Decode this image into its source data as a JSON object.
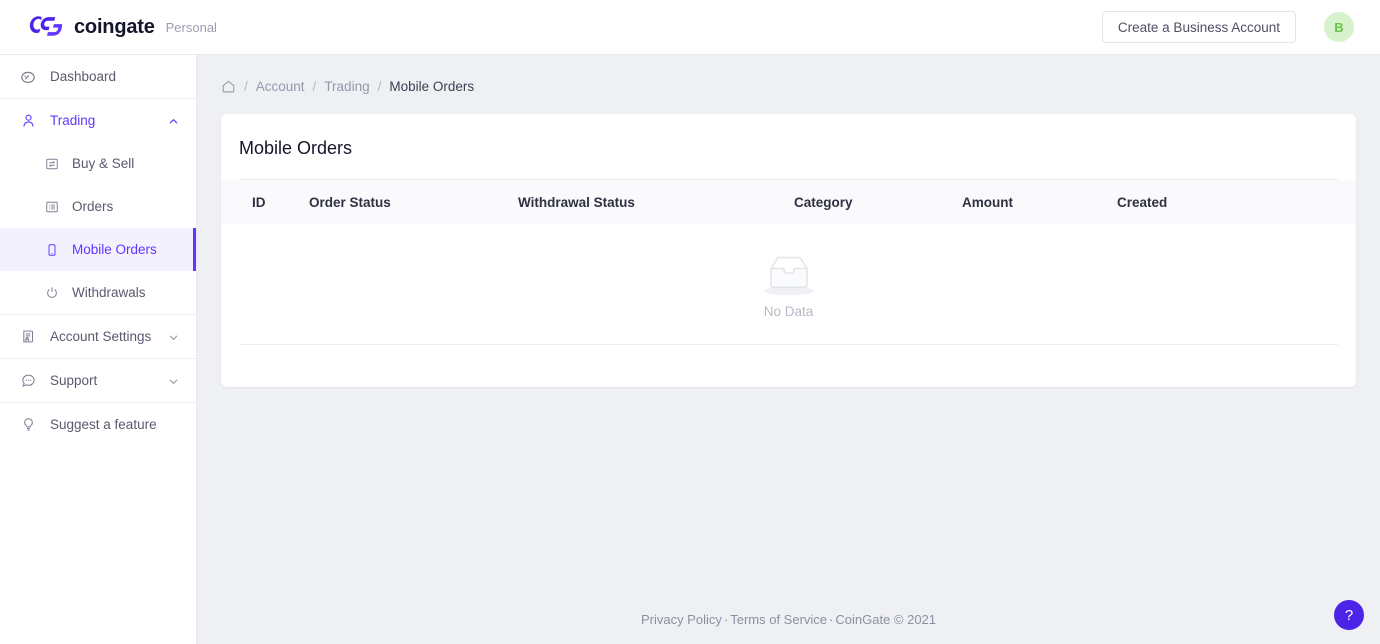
{
  "topbar": {
    "brand_name": "coingate",
    "brand_subtitle": "Personal",
    "business_button": "Create a Business Account",
    "avatar_initial": "B",
    "logo_icon": "coingate-cg-logo-icon",
    "brand_color": "#4d23e8",
    "avatar_bg": "#d7f2cd",
    "avatar_fg": "#6cc24a"
  },
  "sidebar": {
    "items": [
      {
        "label": "Dashboard",
        "icon": "speedometer-icon",
        "type": "item",
        "active": false
      },
      {
        "label": "Trading",
        "icon": "user-icon",
        "type": "parent",
        "expanded": true,
        "chevron": "chevron-up-icon"
      },
      {
        "label": "Buy & Sell",
        "icon": "exchange-card-icon",
        "type": "sub",
        "active": false
      },
      {
        "label": "Orders",
        "icon": "list-icon",
        "type": "sub",
        "active": false
      },
      {
        "label": "Mobile Orders",
        "icon": "mobile-phone-icon",
        "type": "sub",
        "active": true
      },
      {
        "label": "Withdrawals",
        "icon": "power-icon",
        "type": "sub",
        "active": false
      },
      {
        "label": "Account Settings",
        "icon": "profile-document-icon",
        "type": "parent",
        "expanded": false,
        "chevron": "chevron-down-icon"
      },
      {
        "label": "Support",
        "icon": "chat-bubble-icon",
        "type": "parent",
        "expanded": false,
        "chevron": "chevron-down-icon"
      },
      {
        "label": "Suggest a feature",
        "icon": "lightbulb-icon",
        "type": "item",
        "active": false
      }
    ],
    "active_color": "#6236ff",
    "active_bg": "#f4f1fe"
  },
  "breadcrumb": {
    "home_icon": "home-icon",
    "items": [
      {
        "label": "Account",
        "current": false
      },
      {
        "label": "Trading",
        "current": false
      },
      {
        "label": "Mobile Orders",
        "current": true
      }
    ],
    "separator": "/"
  },
  "card": {
    "title": "Mobile Orders",
    "table": {
      "columns": [
        "ID",
        "Order Status",
        "Withdrawal Status",
        "Category",
        "Amount",
        "Created"
      ],
      "rows": [],
      "empty_icon": "empty-inbox-icon",
      "empty_text": "No Data"
    }
  },
  "footer": {
    "privacy": "Privacy Policy",
    "terms": "Terms of Service",
    "copyright": "CoinGate © 2021",
    "separator": "·"
  },
  "help": {
    "label": "?",
    "icon": "question-mark-icon",
    "color": "#4d23e8"
  }
}
